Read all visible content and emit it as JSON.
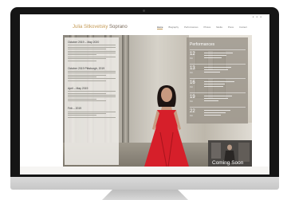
{
  "site": {
    "title_name": "Julia Sitkovetsky",
    "title_role": "Soprano",
    "header_icons": [
      "facebook-icon",
      "twitter-icon",
      "email-icon"
    ]
  },
  "nav": {
    "items": [
      "Home",
      "Biography",
      "Performances",
      "Photos",
      "Media",
      "Press",
      "Contact"
    ],
    "active": "Home"
  },
  "events": [
    {
      "title": "October 2019 – May 2020"
    },
    {
      "title": "October 2019 Pittsburgh, 2019"
    },
    {
      "title": "April – May 2019"
    },
    {
      "title": "Feb – 2019"
    }
  ],
  "performances": {
    "heading": "Performances",
    "entries": [
      {
        "day": "12",
        "month": "Oct"
      },
      {
        "day": "13",
        "month": "Oct"
      },
      {
        "day": "16",
        "month": "Oct"
      },
      {
        "day": "19",
        "month": "Oct"
      },
      {
        "day": "22",
        "month": "Oct"
      }
    ]
  },
  "coming_soon": {
    "label": "Coming Soon"
  },
  "colors": {
    "accent": "#c49a55",
    "dress": "#d61f2a",
    "monitor": "#151515"
  }
}
